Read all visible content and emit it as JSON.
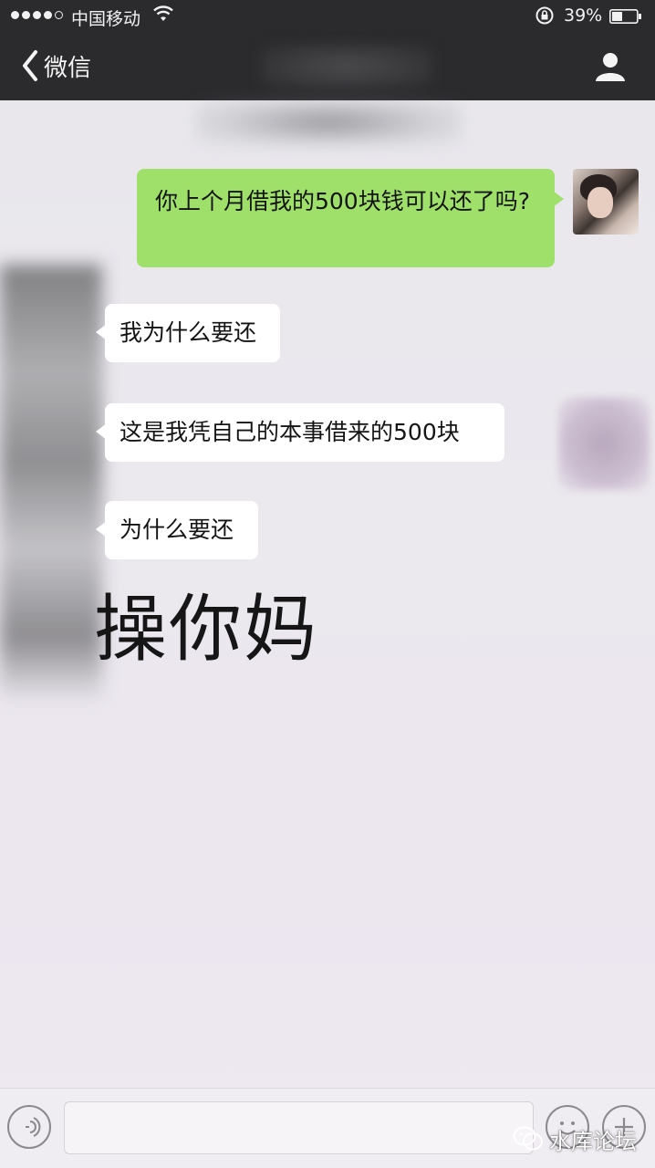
{
  "status_bar": {
    "carrier": "中国移动",
    "battery_percent": "39%"
  },
  "nav": {
    "back_label": "微信"
  },
  "messages": [
    {
      "side": "right",
      "text": "你上个月借我的500块钱可以还了吗?"
    },
    {
      "side": "left",
      "text": "我为什么要还"
    },
    {
      "side": "left",
      "text": "这是我凭自己的本事借来的500块"
    },
    {
      "side": "left",
      "text": "为什么要还"
    }
  ],
  "overlay_text": "操你妈",
  "watermark": {
    "text": "水库论坛"
  },
  "colors": {
    "nav_bg": "#2b2b2e",
    "sent_bubble": "#9fe06a",
    "recv_bubble": "#ffffff",
    "chat_bg": "#ebe8ee"
  },
  "icons": [
    "signal-dots-icon",
    "wifi-icon",
    "lock-rotation-icon",
    "battery-icon",
    "back-chevron-icon",
    "profile-icon",
    "voice-icon",
    "emoji-icon",
    "plus-icon",
    "wechat-logo-icon"
  ]
}
